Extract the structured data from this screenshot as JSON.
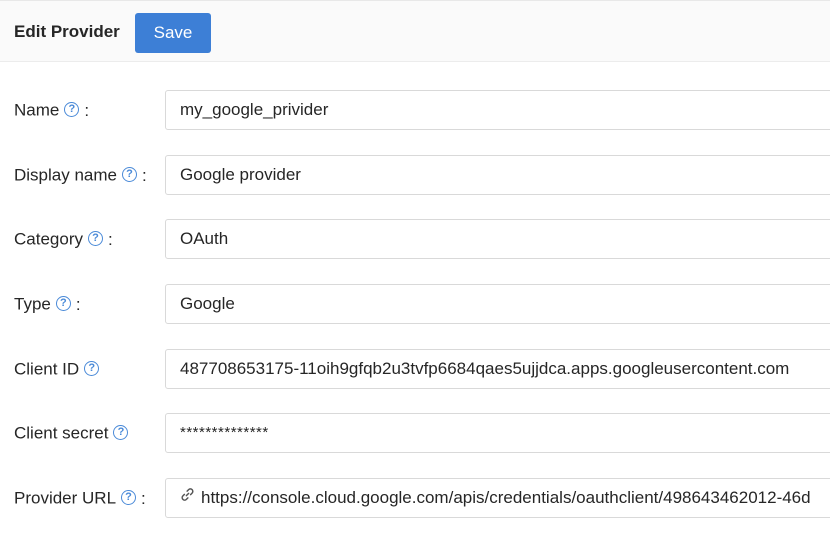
{
  "header": {
    "title": "Edit Provider",
    "save_label": "Save"
  },
  "form": {
    "help_glyph": "?",
    "colon": ":",
    "fields": [
      {
        "label": "Name",
        "value": "my_google_privider"
      },
      {
        "label": "Display name",
        "value": "Google provider"
      },
      {
        "label": "Category",
        "value": "OAuth"
      },
      {
        "label": "Type",
        "value": "Google"
      },
      {
        "label": "Client ID",
        "value": "487708653175-11oih9gfqb2u3tvfp6684qaes5ujjdca.apps.googleusercontent.com"
      },
      {
        "label": "Client secret",
        "value": "**************"
      },
      {
        "label": "Provider URL",
        "value": "https://console.cloud.google.com/apis/credentials/oauthclient/498643462012-46d"
      }
    ]
  },
  "icons": {
    "help": "question-circle-icon",
    "link": "link-icon"
  },
  "colors": {
    "primary": "#3d7fd6",
    "help": "#4a8ad8",
    "border": "#d9d9d9"
  }
}
